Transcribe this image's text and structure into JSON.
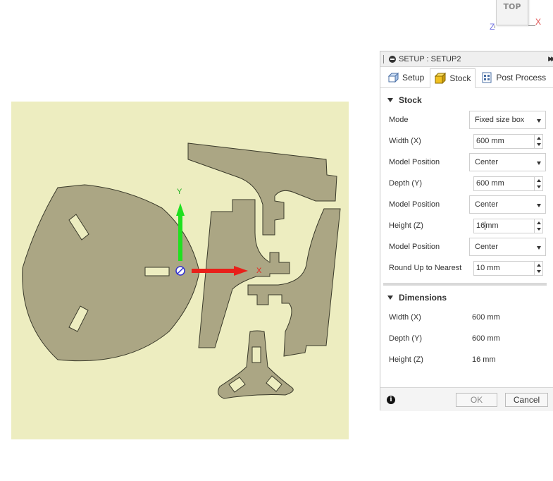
{
  "viewcube": {
    "face": "TOP",
    "x_label": "X",
    "z_label": "Z"
  },
  "canvas": {
    "axis_y_label": "Y",
    "axis_x_label": "X",
    "colors": {
      "stock": "#ededc0",
      "part": "#aba684",
      "x_axis": "#e8201a",
      "y_axis": "#20e020",
      "origin": "#3030d0"
    }
  },
  "panel": {
    "title": "SETUP : SETUP2",
    "tabs": [
      {
        "label": "Setup",
        "icon": "setup-icon"
      },
      {
        "label": "Stock",
        "icon": "stock-cube-icon",
        "active": true
      },
      {
        "label": "Post Process",
        "icon": "post-process-icon"
      }
    ],
    "stock": {
      "header": "Stock",
      "mode_label": "Mode",
      "mode_value": "Fixed size box",
      "width_label": "Width (X)",
      "width_value": "600 mm",
      "model_position_label": "Model Position",
      "model_position_1": "Center",
      "depth_label": "Depth (Y)",
      "depth_value": "600 mm",
      "model_position_2": "Center",
      "height_label": "Height (Z)",
      "height_value_a": "16",
      "height_value_b": "mm",
      "model_position_3": "Center",
      "round_label": "Round Up to Nearest",
      "round_value": "10 mm"
    },
    "dimensions": {
      "header": "Dimensions",
      "width_label": "Width (X)",
      "width_value": "600 mm",
      "depth_label": "Depth (Y)",
      "depth_value": "600 mm",
      "height_label": "Height (Z)",
      "height_value": "16 mm"
    },
    "footer": {
      "info": "i",
      "ok": "OK",
      "cancel": "Cancel"
    }
  }
}
